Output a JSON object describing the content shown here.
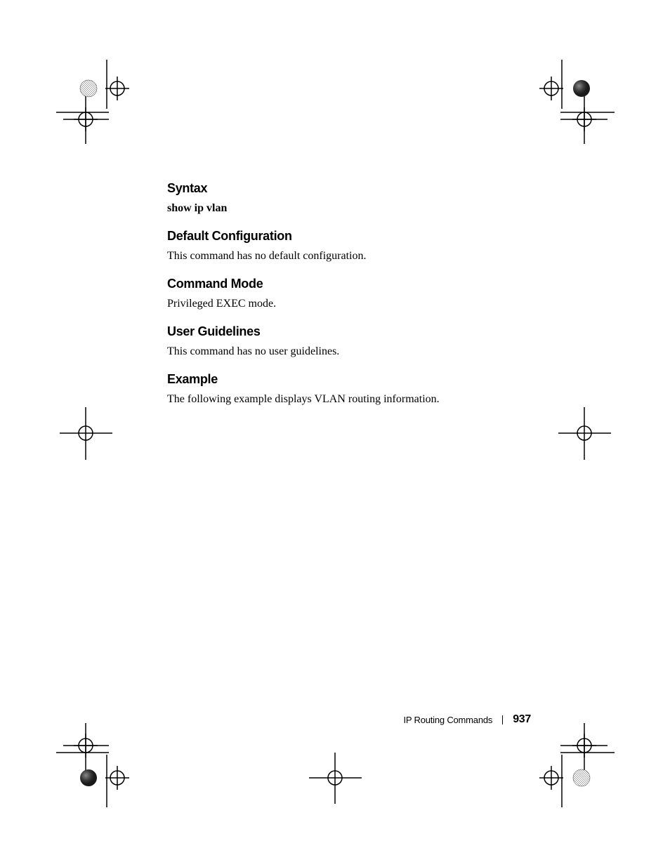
{
  "sections": {
    "syntax": {
      "heading": "Syntax",
      "body": "show ip vlan"
    },
    "default_config": {
      "heading": "Default Configuration",
      "body": "This command has no default configuration."
    },
    "command_mode": {
      "heading": "Command Mode",
      "body": "Privileged EXEC mode."
    },
    "user_guidelines": {
      "heading": "User Guidelines",
      "body": "This command has no user guidelines."
    },
    "example": {
      "heading": "Example",
      "body": "The following example displays VLAN routing information."
    }
  },
  "footer": {
    "title": "IP Routing Commands",
    "page": "937"
  }
}
